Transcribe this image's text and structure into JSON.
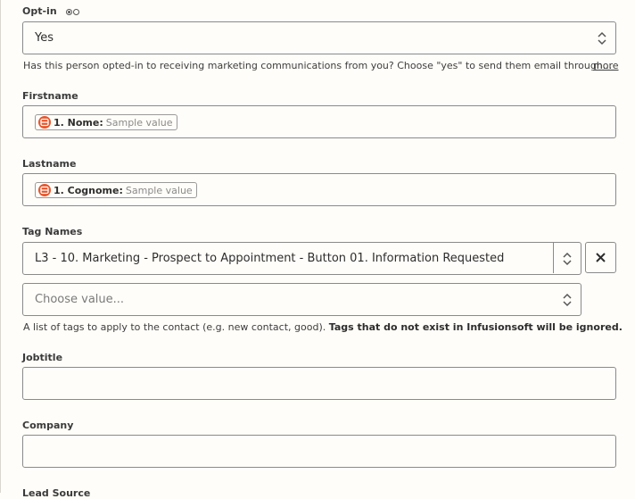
{
  "optin": {
    "label": "Opt-in",
    "value": "Yes",
    "help": "Has this person opted-in to receiving marketing communications from you? Choose \"yes\" to send them email through...",
    "more": "more"
  },
  "firstname": {
    "label": "Firstname",
    "pill_label": "1. Nome:",
    "pill_value": "Sample value"
  },
  "lastname": {
    "label": "Lastname",
    "pill_label": "1. Cognome:",
    "pill_value": "Sample value"
  },
  "tags": {
    "label": "Tag Names",
    "selected": "L3 - 10. Marketing - Prospect to Appointment - Button 01. Information Requested",
    "placeholder": "Choose value...",
    "help_plain": "A list of tags to apply to the contact (e.g. new contact, good). ",
    "help_bold": "Tags that do not exist in Infusionsoft will be ignored."
  },
  "jobtitle": {
    "label": "Jobtitle",
    "value": ""
  },
  "company": {
    "label": "Company",
    "value": ""
  },
  "lead_source": {
    "label": "Lead Source"
  },
  "colors": {
    "pill_icon": "#e8552b",
    "border": "#8a8a8a",
    "background": "#fffdf9"
  }
}
